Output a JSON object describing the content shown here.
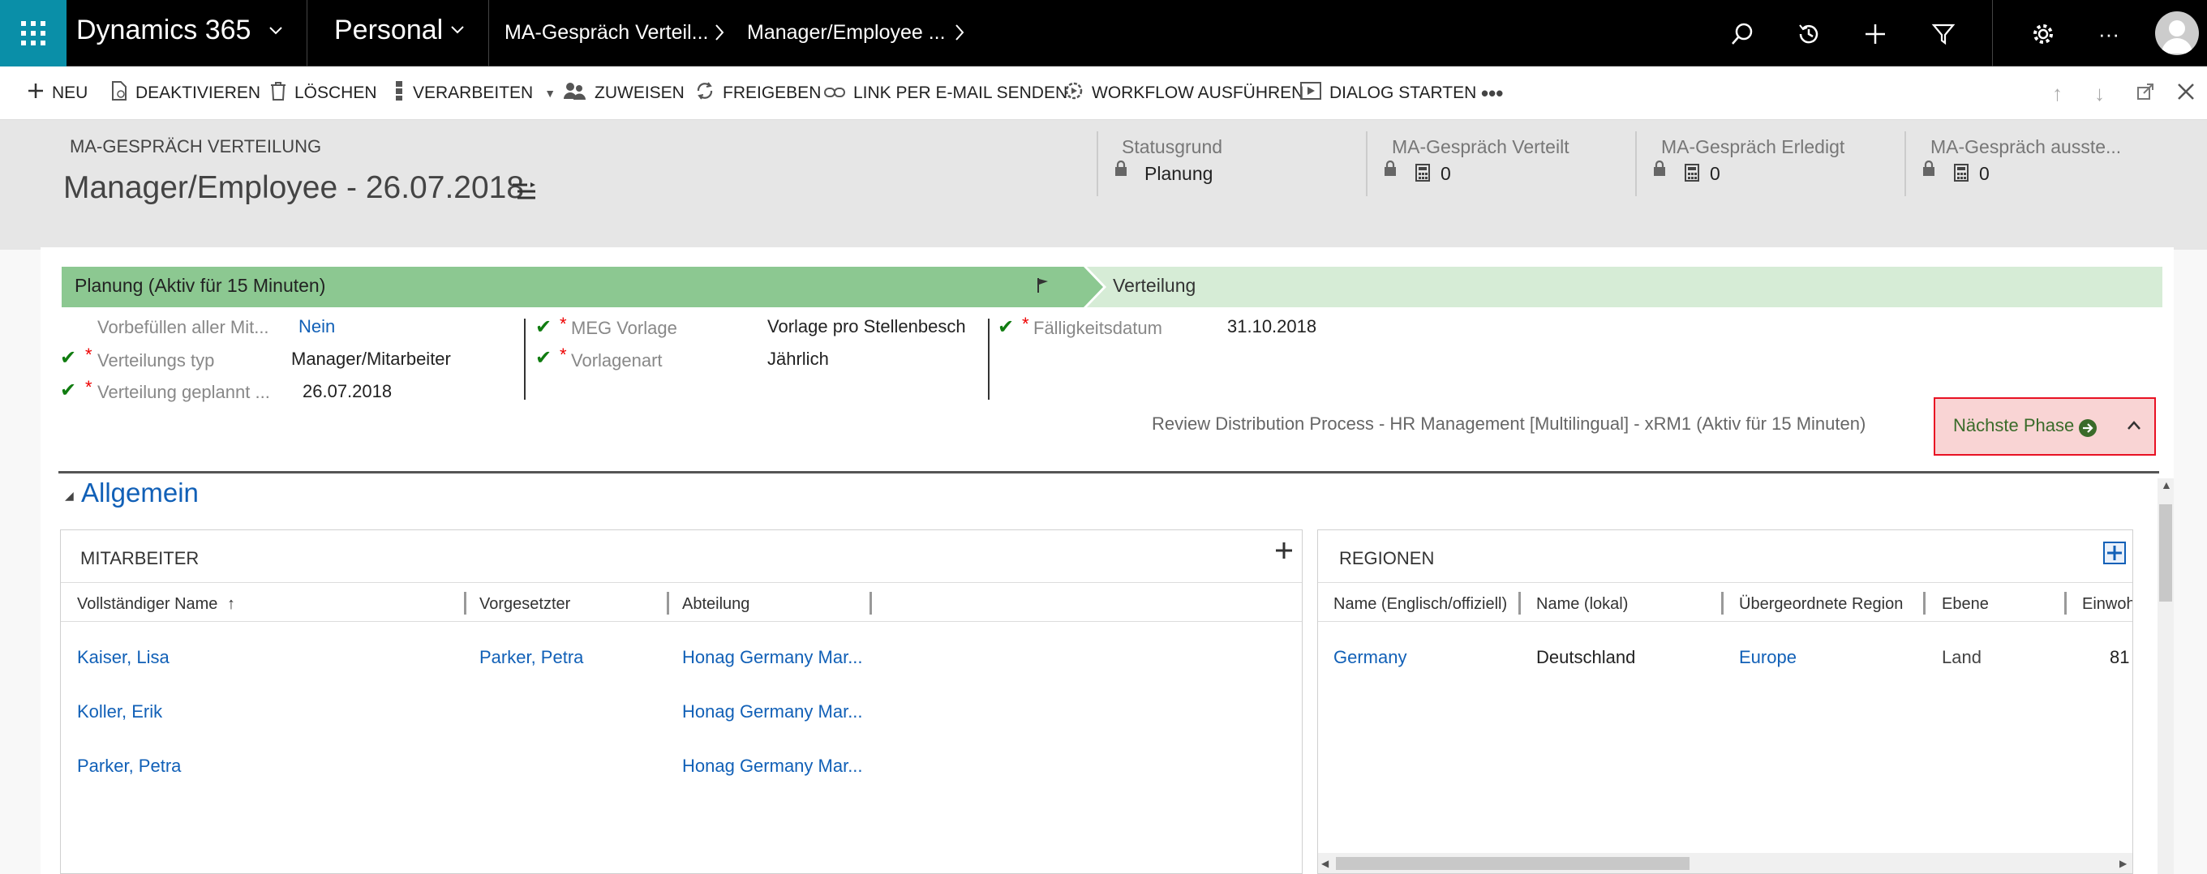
{
  "topnav": {
    "app_title": "Dynamics 365",
    "area": "Personal",
    "breadcrumb1": "MA-Gespräch Verteil...",
    "breadcrumb2": "Manager/Employee ..."
  },
  "commands": {
    "new": "NEU",
    "deactivate": "DEAKTIVIEREN",
    "delete": "LÖSCHEN",
    "process": "VERARBEITEN",
    "assign": "ZUWEISEN",
    "share": "FREIGEBEN",
    "email_link": "LINK PER E-MAIL SENDEN",
    "run_workflow": "WORKFLOW AUSFÜHREN",
    "start_dialog": "DIALOG STARTEN",
    "more": "•••"
  },
  "header": {
    "entity": "MA-GESPRÄCH VERTEILUNG",
    "title": "Manager/Employee - 26.07.2018",
    "fields": [
      {
        "label": "Statusgrund",
        "value": "Planung"
      },
      {
        "label": "MA-Gespräch Verteilt",
        "value": "0"
      },
      {
        "label": "MA-Gespräch Erledigt",
        "value": "0"
      },
      {
        "label": "MA-Gespräch ausste...",
        "value": "0"
      }
    ]
  },
  "process": {
    "active_stage": "Planung (Aktiv für 15 Minuten)",
    "next_stage": "Verteilung",
    "col1": [
      {
        "label": "Vorbefüllen aller Mit...",
        "value": "Nein"
      },
      {
        "label": "Verteilungs typ",
        "value": "Manager/Mitarbeiter"
      },
      {
        "label": "Verteilung geplannt ...",
        "value": "26.07.2018"
      }
    ],
    "col2": [
      {
        "label": "MEG Vorlage",
        "value": "Vorlage pro Stellenbesch"
      },
      {
        "label": "Vorlagenart",
        "value": "Jährlich"
      }
    ],
    "col3": [
      {
        "label": "Fälligkeitsdatum",
        "value": "31.10.2018"
      }
    ],
    "process_name": "Review Distribution Process - HR Management [Multilingual] - xRM1 (Aktiv für 15 Minuten)",
    "next_phase": "Nächste Phase"
  },
  "section": {
    "title": "Allgemein"
  },
  "employees": {
    "title": "MITARBEITER",
    "columns": [
      "Vollständiger Name",
      "Vorgesetzter",
      "Abteilung"
    ],
    "rows": [
      [
        "Kaiser, Lisa",
        "Parker, Petra",
        "Honag Germany Mar..."
      ],
      [
        "Koller, Erik",
        "",
        "Honag Germany Mar..."
      ],
      [
        "Parker, Petra",
        "",
        "Honag Germany Mar..."
      ]
    ]
  },
  "regions": {
    "title": "REGIONEN",
    "columns": [
      "Name (Englisch/offiziell)",
      "Name (lokal)",
      "Übergeordnete Region",
      "Ebene",
      "Einwoh"
    ],
    "rows": [
      [
        "Germany",
        "Deutschland",
        "Europe",
        "Land",
        "81"
      ]
    ]
  },
  "colors": {
    "topbar": "#000000",
    "waffle": "#0a8fa8",
    "stage_active": "#8cc891",
    "stage_next": "#d6ecd6",
    "link": "#1160b7",
    "next_phase_bg": "#f9d4d4",
    "next_phase_border": "#e81123"
  }
}
